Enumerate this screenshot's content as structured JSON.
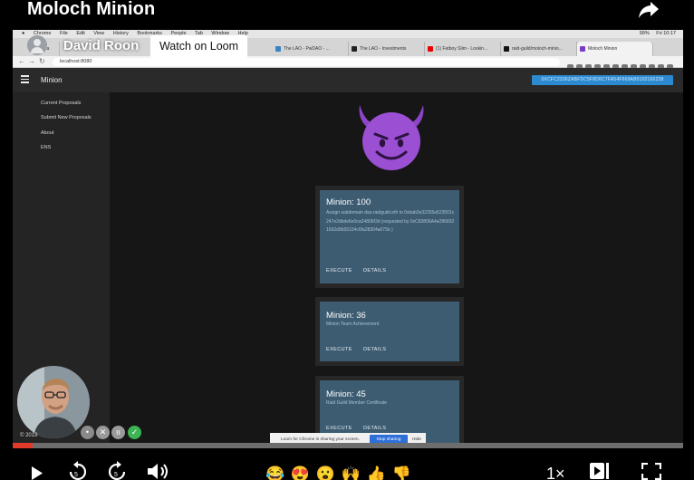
{
  "loom": {
    "video_title": "Moloch Minion",
    "presenter_name": "David Roon",
    "watch_button": "Watch on Loom",
    "copyright": "© 2019",
    "speed": "1×",
    "progress_fraction": 0.03,
    "reactions": [
      "😂",
      "😍",
      "😮",
      "🙌",
      "👍",
      "👎"
    ]
  },
  "mac_menu": {
    "apple": "",
    "items": [
      "Chrome",
      "File",
      "Edit",
      "View",
      "History",
      "Bookmarks",
      "People",
      "Tab",
      "Window",
      "Help"
    ],
    "status": [
      "99%",
      "Fri 10:17"
    ]
  },
  "browser": {
    "tabs": [
      {
        "label": "Ca"
      },
      {
        "label": "The LAO - PwDAO - ..."
      },
      {
        "label": "The LAO - Investments"
      },
      {
        "label": "(1) Fatboy Slim - Lookin..."
      },
      {
        "label": "raid-guild/moloch-minio..."
      },
      {
        "label": "Moloch Minion"
      }
    ],
    "url": "localhost:8080"
  },
  "app": {
    "title": "Minion",
    "wallet_address": "0XCFC2206ZABFDC5F8D6C7FA54F669AB0102166238",
    "nav": [
      "Current Proposals",
      "Submit New Proposals",
      "About",
      "ENS"
    ],
    "emoji": "😈"
  },
  "cards": [
    {
      "title": "Minion: 100",
      "description": "Assign subdomain dao.raidguild.eth to 0xbab3e32355a523501c247e2dbde6e0ca24806f3d (requested by 0xC83806A4e2866921692d9b55104c6fa28304a075b )",
      "execute_label": "EXECUTE",
      "details_label": "DETAILS"
    },
    {
      "title": "Minion: 36",
      "description": "Minion Team Achievement",
      "execute_label": "EXECUTE",
      "details_label": "DETAILS"
    },
    {
      "title": "Minion: 45",
      "description": "Raid Guild Member Certificate",
      "execute_label": "EXECUTE",
      "details_label": "DETAILS"
    }
  ],
  "share_bar": {
    "message": "Loom for Chrome is sharing your screen.",
    "stop_label": "Stop sharing",
    "hide_label": "Hide"
  }
}
